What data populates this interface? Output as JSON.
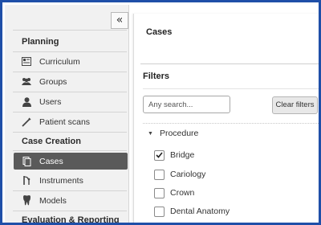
{
  "sidebar": {
    "collapse_symbol": "«",
    "sections": [
      {
        "title": "Planning",
        "items": [
          {
            "label": "Curriculum",
            "icon": "curriculum-icon",
            "glyph": "▤"
          },
          {
            "label": "Groups",
            "icon": "groups-icon",
            "glyph": "👥"
          },
          {
            "label": "Users",
            "icon": "user-icon",
            "glyph": "👤"
          },
          {
            "label": "Patient scans",
            "icon": "scan-icon",
            "glyph": "⟋"
          }
        ]
      },
      {
        "title": "Case Creation",
        "items": [
          {
            "label": "Cases",
            "icon": "cases-icon",
            "glyph": "▭",
            "active": true
          },
          {
            "label": "Instruments",
            "icon": "instruments-icon",
            "glyph": "⚕"
          },
          {
            "label": "Models",
            "icon": "tooth-icon",
            "glyph": "▾"
          }
        ]
      },
      {
        "title": "Evaluation & Reporting",
        "items": []
      }
    ]
  },
  "main": {
    "title": "Cases",
    "filters": {
      "heading": "Filters",
      "search_placeholder": "Any search...",
      "clear_label": "Clear filters",
      "group": {
        "label": "Procedure",
        "caret": "▼",
        "options": [
          {
            "label": "Bridge",
            "checked": true
          },
          {
            "label": "Cariology",
            "checked": false
          },
          {
            "label": "Crown",
            "checked": false
          },
          {
            "label": "Dental Anatomy",
            "checked": false
          }
        ]
      }
    }
  },
  "colors": {
    "frame_border": "#1f4fa8",
    "active_item_bg": "#5a5a5a",
    "sidebar_bg": "#f1f1f1"
  }
}
